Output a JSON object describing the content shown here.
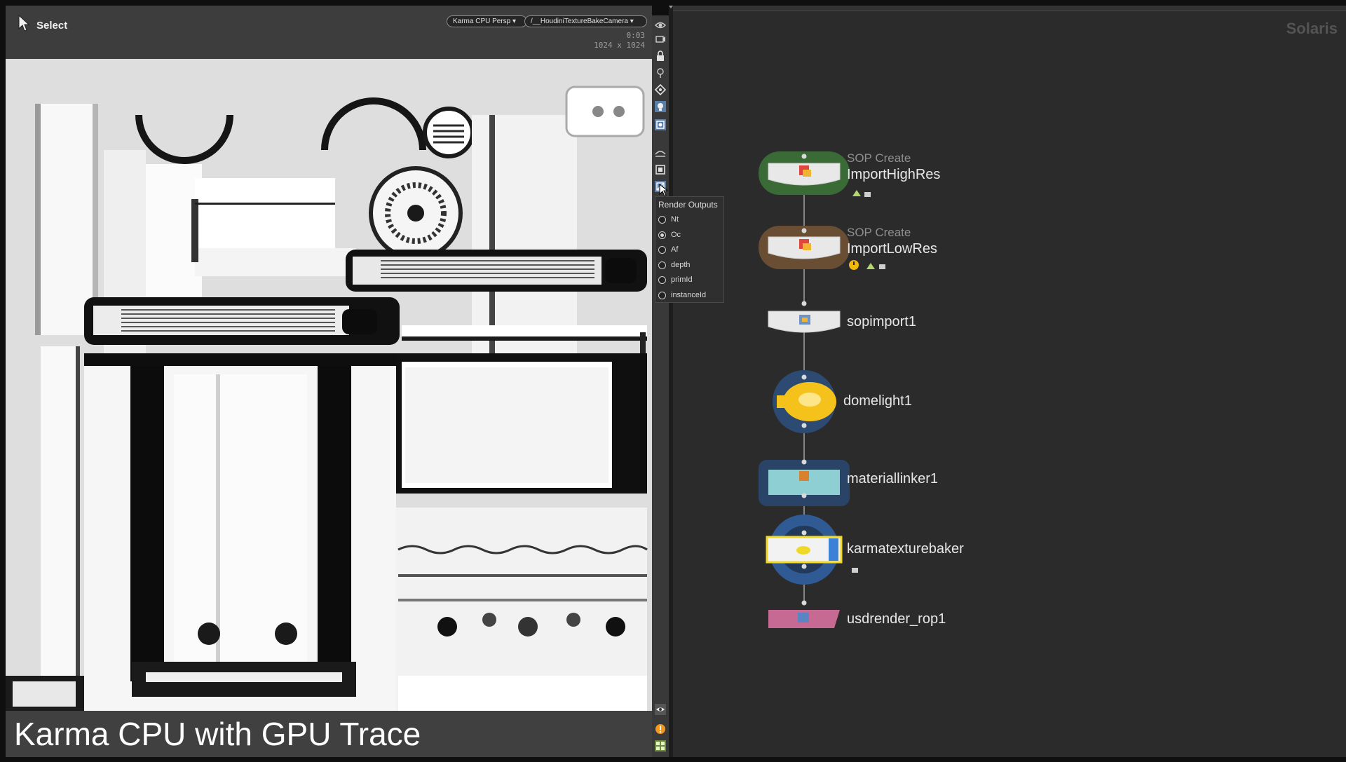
{
  "viewport": {
    "tool": "Select",
    "renderer": "Karma CPU Persp",
    "camera": "/__HoudiniTextureBakeCamera",
    "time": "0:03",
    "resolution": "1024 x 1024",
    "caption": "Karma CPU with GPU Trace"
  },
  "render_outputs": {
    "title": "Render Outputs",
    "items": [
      {
        "label": "Nt",
        "selected": false
      },
      {
        "label": "Oc",
        "selected": true
      },
      {
        "label": "Af",
        "selected": false
      },
      {
        "label": "depth",
        "selected": false
      },
      {
        "label": "primId",
        "selected": false
      },
      {
        "label": "instanceId",
        "selected": false
      }
    ]
  },
  "network": {
    "context": "Solaris",
    "nodes": [
      {
        "type": "SOP Create",
        "name": "ImportHighRes",
        "flag_color": "#3a6a36"
      },
      {
        "type": "SOP Create",
        "name": "ImportLowRes",
        "flag_color": "#6a4e34"
      },
      {
        "type": "",
        "name": "sopimport1"
      },
      {
        "type": "",
        "name": "domelight1",
        "color": "#f4c21a"
      },
      {
        "type": "",
        "name": "materiallinker1",
        "color": "#8ecfd4"
      },
      {
        "type": "",
        "name": "karmatexturebaker",
        "color": "#f0d826"
      },
      {
        "type": "",
        "name": "usdrender_rop1",
        "color": "#c76a93"
      }
    ]
  },
  "icons": [
    "select-arrow-icon",
    "eye-icon",
    "camera-icon",
    "lock-icon",
    "pin-icon",
    "snapshot-icon",
    "light-icon",
    "render-icon",
    "display-options-icon",
    "render-outputs-icon",
    "visibility-icon",
    "warning-icon",
    "grid-icon"
  ]
}
